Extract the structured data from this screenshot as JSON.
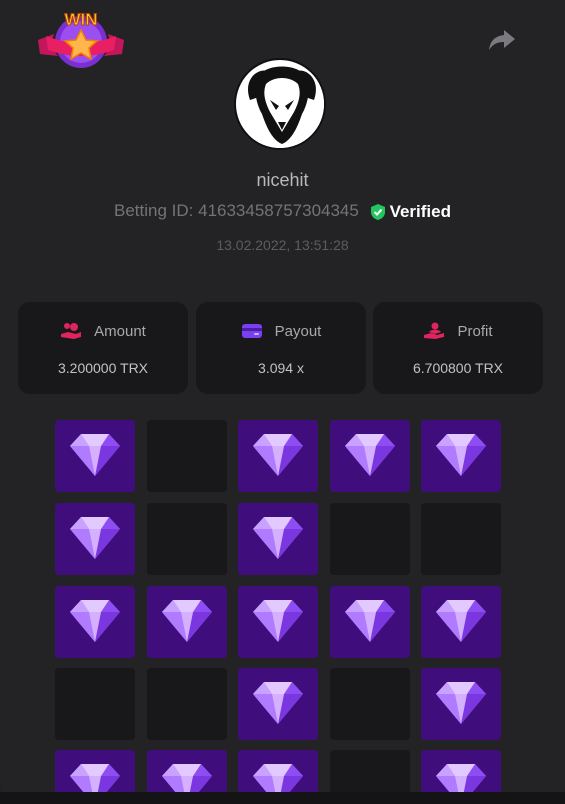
{
  "header": {
    "logo_text": "WIN"
  },
  "user": {
    "name": "nicehit",
    "betting_id_label": "Betting ID:",
    "betting_id": "41633458757304345",
    "verified_label": "Verified",
    "timestamp": "13.02.2022, 13:51:28"
  },
  "stats": [
    {
      "label": "Amount",
      "value": "3.200000 TRX",
      "icon": "coins-in-hand-icon",
      "color": "#e0245e"
    },
    {
      "label": "Payout",
      "value": "3.094 x",
      "icon": "wallet-card-icon",
      "color": "#7b3ff2"
    },
    {
      "label": "Profit",
      "value": "6.700800 TRX",
      "icon": "hand-user-icon",
      "color": "#e0245e"
    }
  ],
  "grid": [
    [
      "gem",
      "empty",
      "gem",
      "gem",
      "gem"
    ],
    [
      "gem",
      "empty",
      "gem",
      "empty",
      "empty"
    ],
    [
      "gem",
      "gem",
      "gem",
      "gem",
      "gem"
    ],
    [
      "empty",
      "empty",
      "gem",
      "empty",
      "gem"
    ],
    [
      "gem",
      "gem",
      "gem",
      "empty",
      "gem"
    ]
  ],
  "colors": {
    "gem_tile": "#3f0e7c",
    "empty_tile": "#18181a",
    "verified": "#22c55e"
  }
}
